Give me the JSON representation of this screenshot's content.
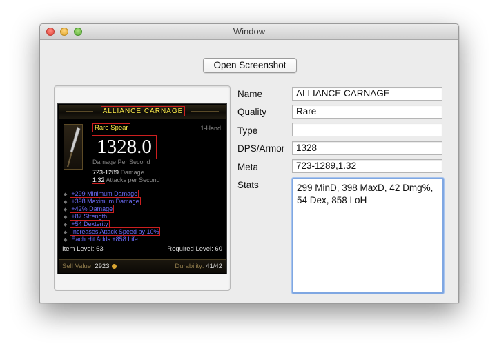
{
  "window": {
    "title": "Window"
  },
  "toolbar": {
    "open_label": "Open Screenshot"
  },
  "tooltip": {
    "item_name": "ALLIANCE CARNAGE",
    "item_type": "Rare Spear",
    "hand": "1-Hand",
    "dps_value": "1328.0",
    "dps_label": "Damage Per Second",
    "damage_range": "723-1289",
    "damage_word": "Damage",
    "attacks_value": "1.32",
    "attacks_word": "Attacks per Second",
    "affixes": [
      "+299 Minimum Damage",
      "+398 Maximum Damage",
      "+42% Damage",
      "+87 Strength",
      "+54 Dexterity",
      "Increases Attack Speed by 10%",
      "Each Hit Adds +858 Life"
    ],
    "item_level": "Item Level: 63",
    "required_level": "Required Level: 60",
    "sell_label": "Sell Value:",
    "sell_value": "2923",
    "durability_label": "Durability:",
    "durability_value": "41/42",
    "colors": {
      "name_yellow": "#fbea4a",
      "affix_blue": "#6c6cf6",
      "highlight_red": "#cc1f1f"
    }
  },
  "form": {
    "name_label": "Name",
    "name_value": "ALLIANCE CARNAGE",
    "quality_label": "Quality",
    "quality_value": "Rare",
    "type_label": "Type",
    "type_value": "",
    "dps_label": "DPS/Armor",
    "dps_value": "1328",
    "meta_label": "Meta",
    "meta_value": "723-1289,1.32",
    "stats_label": "Stats",
    "stats_value": "299 MinD, 398 MaxD, 42 Dmg%,\n54 Dex, 858 LoH"
  }
}
